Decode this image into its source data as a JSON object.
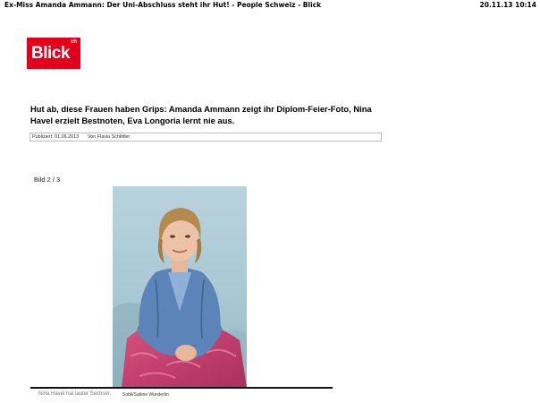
{
  "print_header": {
    "title": "Ex-Miss Amanda Ammann: Der Uni-Abschluss steht ihr Hut! - People Schweiz - Blick",
    "datetime": "20.11.13 10:14"
  },
  "logo": {
    "text": "Blick",
    "suffix": "ch"
  },
  "article": {
    "headline": "Hut ab, diese Frauen haben Grips: Amanda Ammann zeigt ihr Diplom-Feier-Foto, Nina Havel erzielt Bestnoten, Eva Longoria lernt nie aus.",
    "published": "Publiziert: 01.06.2013",
    "author": "Von Flavia Schlittler"
  },
  "gallery": {
    "counter": "Bild 2 / 3",
    "caption": "Nina Havel hat lauter Sechser.",
    "credit": "Sobli/Sabine Wunderlin"
  }
}
